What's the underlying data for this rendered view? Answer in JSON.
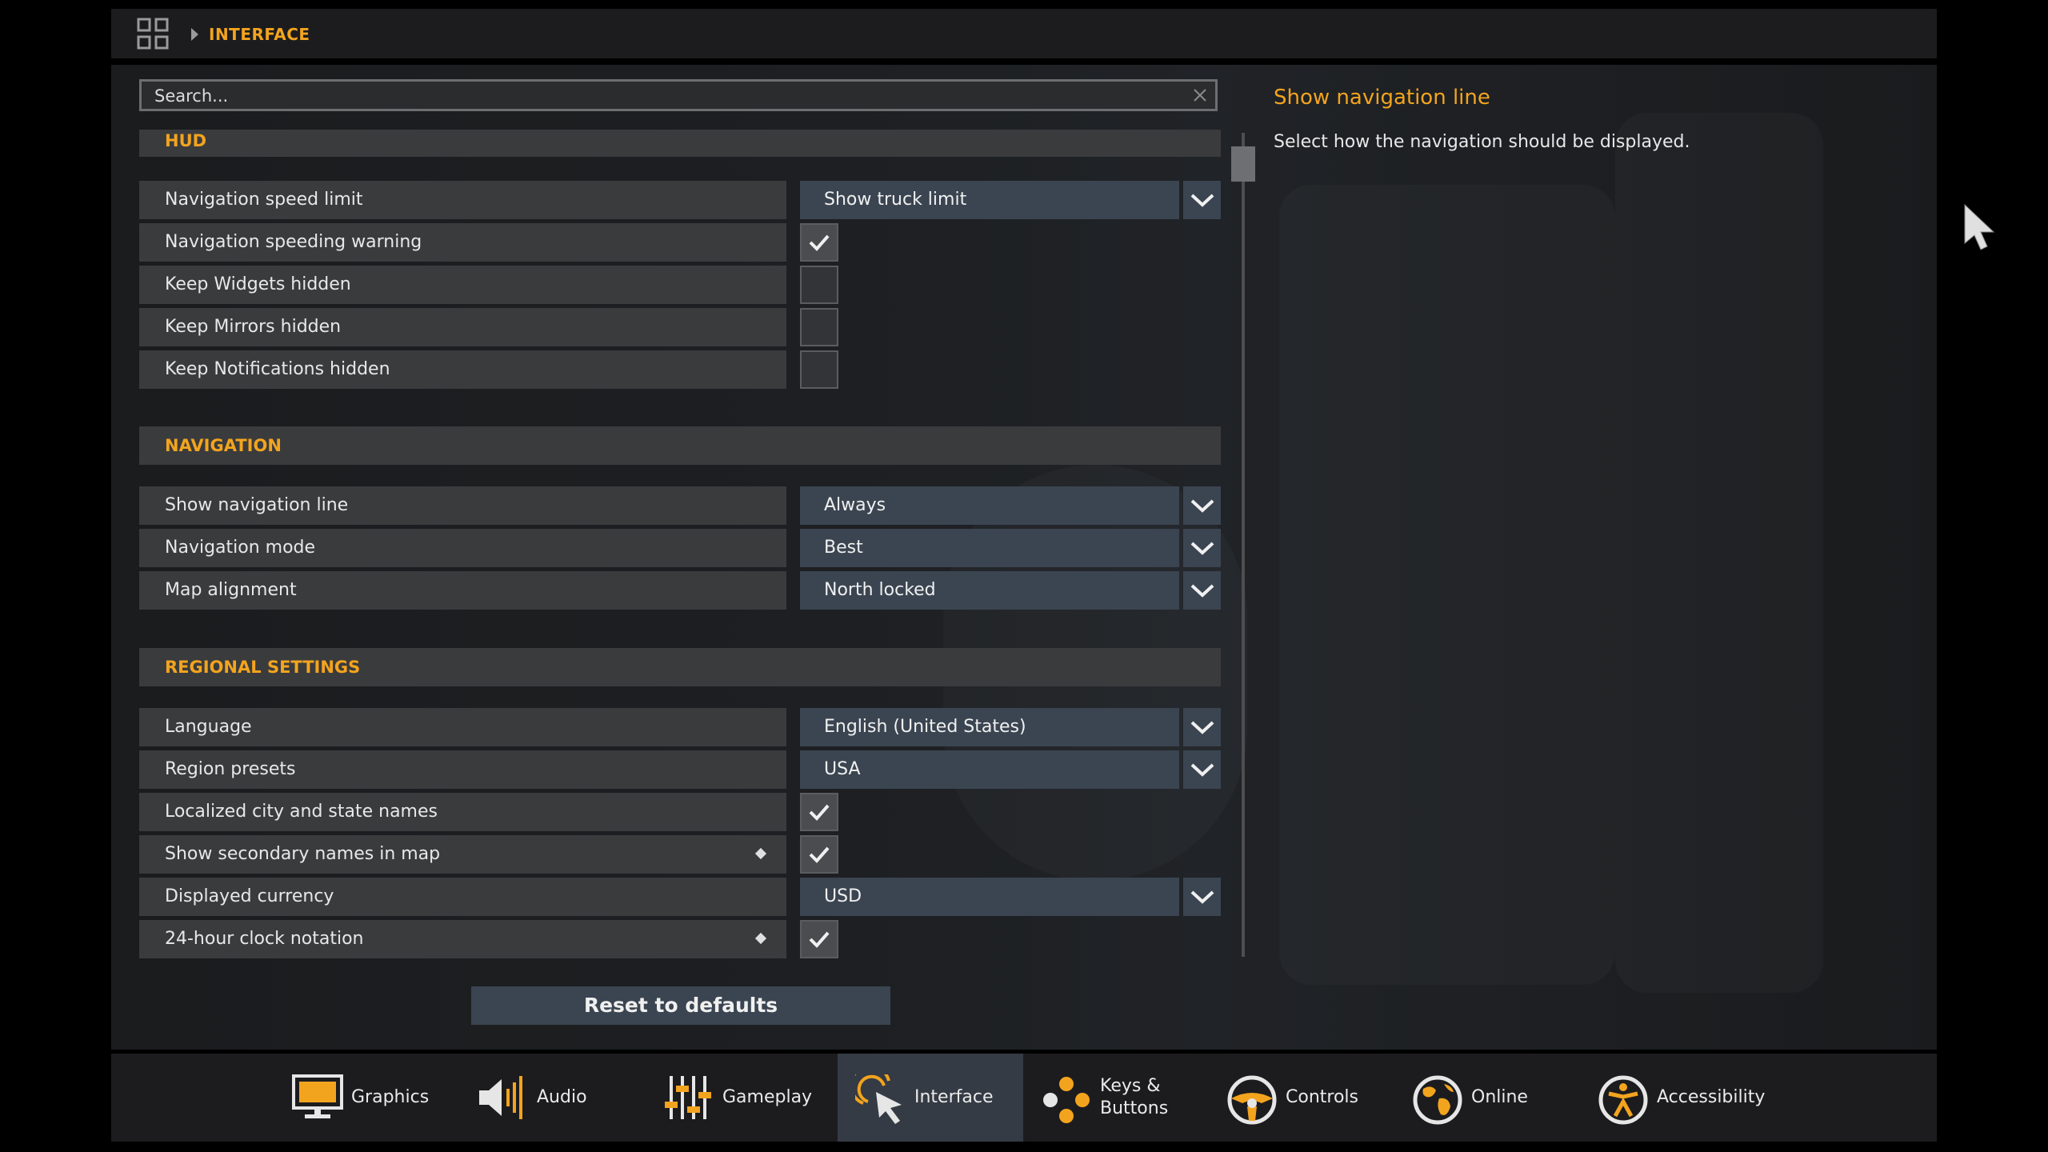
{
  "breadcrumb": {
    "current": "INTERFACE"
  },
  "search": {
    "placeholder": "Search..."
  },
  "sections": {
    "hud": {
      "title": "HUD",
      "rows": {
        "speed_limit": {
          "label": "Navigation speed limit",
          "value": "Show truck limit"
        },
        "speeding_warning": {
          "label": "Navigation speeding warning",
          "checked": true
        },
        "widgets_hidden": {
          "label": "Keep Widgets hidden",
          "checked": false
        },
        "mirrors_hidden": {
          "label": "Keep Mirrors hidden",
          "checked": false
        },
        "notifications_hidden": {
          "label": "Keep Notifications hidden",
          "checked": false
        }
      }
    },
    "navigation": {
      "title": "NAVIGATION",
      "rows": {
        "nav_line": {
          "label": "Show navigation line",
          "value": "Always"
        },
        "nav_mode": {
          "label": "Navigation mode",
          "value": "Best"
        },
        "map_alignment": {
          "label": "Map alignment",
          "value": "North locked"
        }
      }
    },
    "regional": {
      "title": "REGIONAL SETTINGS",
      "rows": {
        "language": {
          "label": "Language",
          "value": "English (United States)"
        },
        "region_presets": {
          "label": "Region presets",
          "value": "USA"
        },
        "localized_names": {
          "label": "Localized city and state names",
          "checked": true
        },
        "secondary_names": {
          "label": "Show secondary names in map",
          "checked": true
        },
        "currency": {
          "label": "Displayed currency",
          "value": "USD"
        },
        "clock": {
          "label": "24-hour clock notation",
          "checked": true
        }
      }
    }
  },
  "info": {
    "title": "Show navigation line",
    "description": "Select how the navigation should be displayed."
  },
  "reset_label": "Reset to defaults",
  "tabs": {
    "graphics": "Graphics",
    "audio": "Audio",
    "gameplay": "Gameplay",
    "interface": "Interface",
    "keys_line1": "Keys &",
    "keys_line2": "Buttons",
    "controls": "Controls",
    "online": "Online",
    "accessibility": "Accessibility"
  },
  "colors": {
    "accent": "#f3a41e",
    "dropdown_bg": "#3b4551",
    "row_bg": "#3a3b3d",
    "active_tab": "#353b44"
  }
}
